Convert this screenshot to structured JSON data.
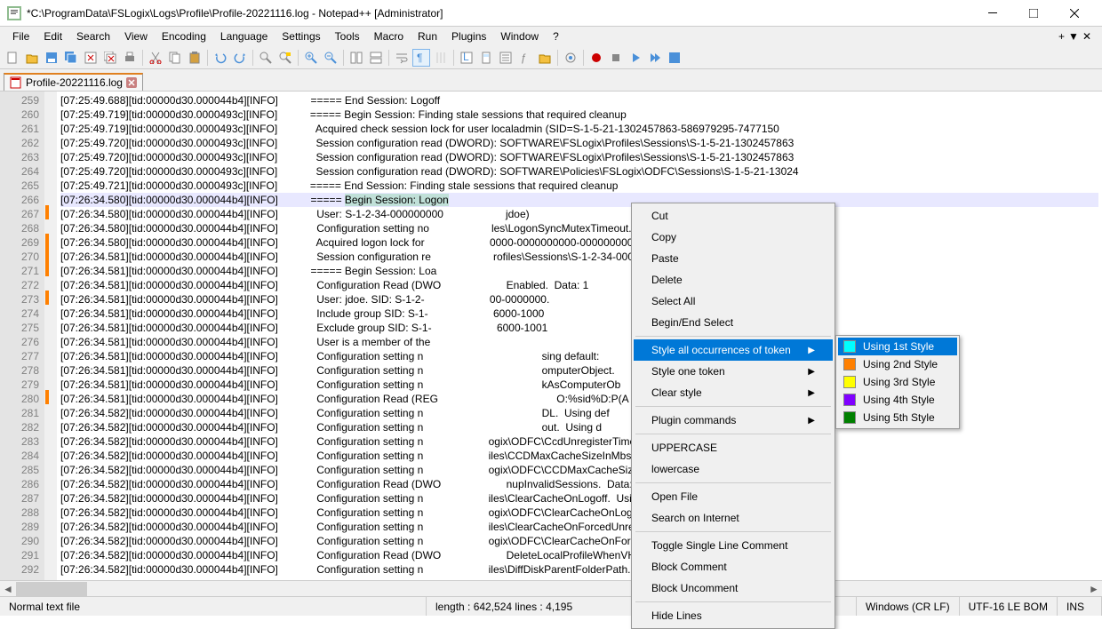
{
  "title": "*C:\\ProgramData\\FSLogix\\Logs\\Profile\\Profile-20221116.log - Notepad++ [Administrator]",
  "menus": [
    "File",
    "Edit",
    "Search",
    "View",
    "Encoding",
    "Language",
    "Settings",
    "Tools",
    "Macro",
    "Run",
    "Plugins",
    "Window",
    "?"
  ],
  "tab": {
    "name": "Profile-20221116.log"
  },
  "gutter_start": 259,
  "gutter_count": 34,
  "changed_lines": [
    267,
    269,
    270,
    271,
    273,
    280
  ],
  "highlighted_line": 266,
  "lines": [
    "[07:25:49.688][tid:00000d30.000044b4][INFO]           ===== End Session: Logoff",
    "[07:25:49.719][tid:00000d30.0000493c][INFO]           ===== Begin Session: Finding stale sessions that required cleanup",
    "[07:25:49.719][tid:00000d30.0000493c][INFO]             Acquired check session lock for user localadmin (SID=S-1-5-21-1302457863-586979295-7477150",
    "[07:25:49.720][tid:00000d30.0000493c][INFO]             Session configuration read (DWORD): SOFTWARE\\FSLogix\\Profiles\\Sessions\\S-1-5-21-1302457863",
    "[07:25:49.720][tid:00000d30.0000493c][INFO]             Session configuration read (DWORD): SOFTWARE\\FSLogix\\Profiles\\Sessions\\S-1-5-21-1302457863",
    "[07:25:49.720][tid:00000d30.0000493c][INFO]             Session configuration read (DWORD): SOFTWARE\\Policies\\FSLogix\\ODFC\\Sessions\\S-1-5-21-13024",
    "[07:25:49.721][tid:00000d30.0000493c][INFO]           ===== End Session: Finding stale sessions that required cleanup",
    "[07:26:34.580][tid:00000d30.000044b4][INFO]           ===== ",
    "[07:26:34.580][tid:00000d30.000044b4][INFO]             User: S-1-2-34-000000000                     jdoe)",
    "[07:26:34.580][tid:00000d30.000044b4][INFO]             Configuration setting no                     les\\LogonSyncMutexTimeout.  Using d",
    "[07:26:34.580][tid:00000d30.000044b4][INFO]             Acquired logon lock for                      0000-0000000000-0000000000-0000000) (E",
    "[07:26:34.581][tid:00000d30.000044b4][INFO]             Session configuration re                     rofiles\\Sessions\\S-1-2-34-000000000-",
    "[07:26:34.581][tid:00000d30.000044b4][INFO]           ===== Begin Session: Loa",
    "[07:26:34.581][tid:00000d30.000044b4][INFO]             Configuration Read (DWO                      Enabled.  Data: 1",
    "[07:26:34.581][tid:00000d30.000044b4][INFO]             User: jdoe. SID: S-1-2-                      00-0000000.",
    "[07:26:34.581][tid:00000d30.000044b4][INFO]             Include group SID: S-1-                      6000-1000",
    "[07:26:34.581][tid:00000d30.000044b4][INFO]             Exclude group SID: S-1-                      6000-1001",
    "[07:26:34.581][tid:00000d30.000044b4][INFO]             User is a member of the",
    "[07:26:34.581][tid:00000d30.000044b4][INFO]             Configuration setting n                                        sing default:",
    "[07:26:34.581][tid:00000d30.000044b4][INFO]             Configuration setting n                                        omputerObject.",
    "[07:26:34.581][tid:00000d30.000044b4][INFO]             Configuration setting n                                        kAsComputerOb",
    "[07:26:34.581][tid:00000d30.000044b4][INFO]             Configuration Read (REG                                        O:%sid%D:P(A",
    "[07:26:34.582][tid:00000d30.000044b4][INFO]             Configuration setting n                                        DL.  Using def",
    "[07:26:34.582][tid:00000d30.000044b4][INFO]             Configuration setting n                                        out.  Using d",
    "[07:26:34.582][tid:00000d30.000044b4][INFO]             Configuration setting n                      ogix\\ODFC\\CcdUnregisterTimeout.  Us",
    "[07:26:34.582][tid:00000d30.000044b4][INFO]             Configuration setting n                      iles\\CCDMaxCacheSizeInMbs.  Using d",
    "[07:26:34.582][tid:00000d30.000044b4][INFO]             Configuration setting n                      ogix\\ODFC\\CCDMaxCacheSizeInMbs.  Us",
    "[07:26:34.582][tid:00000d30.000044b4][INFO]             Configuration Read (DWO                      nupInvalidSessions.  Data: 1",
    "[07:26:34.582][tid:00000d30.000044b4][INFO]             Configuration setting n                      iles\\ClearCacheOnLogoff.  Using def",
    "[07:26:34.582][tid:00000d30.000044b4][INFO]             Configuration setting n                      ogix\\ODFC\\ClearCacheOnLogoff.  Usir",
    "[07:26:34.582][tid:00000d30.000044b4][INFO]             Configuration setting n                      iles\\ClearCacheOnForcedUnregister.",
    "[07:26:34.582][tid:00000d30.000044b4][INFO]             Configuration setting n                      ogix\\ODFC\\ClearCacheOnForcedUnregis",
    "[07:26:34.582][tid:00000d30.000044b4][INFO]             Configuration Read (DWO                      DeleteLocalProfileWhenVHDShouldAppl",
    "[07:26:34.582][tid:00000d30.000044b4][INFO]             Configuration setting n                      iles\\DiffDiskParentFolderPath.  Usi"
  ],
  "selected_text": "Begin Session: Logon",
  "context_menu": {
    "items": [
      {
        "label": "Cut"
      },
      {
        "label": "Copy"
      },
      {
        "label": "Paste"
      },
      {
        "label": "Delete"
      },
      {
        "label": "Select All"
      },
      {
        "label": "Begin/End Select"
      },
      {
        "sep": true
      },
      {
        "label": "Style all occurrences of token",
        "sub": true,
        "hl": true
      },
      {
        "label": "Style one token",
        "sub": true
      },
      {
        "label": "Clear style",
        "sub": true
      },
      {
        "sep": true
      },
      {
        "label": "Plugin commands",
        "sub": true
      },
      {
        "sep": true
      },
      {
        "label": "UPPERCASE"
      },
      {
        "label": "lowercase"
      },
      {
        "sep": true
      },
      {
        "label": "Open File"
      },
      {
        "label": "Search on Internet"
      },
      {
        "sep": true
      },
      {
        "label": "Toggle Single Line Comment"
      },
      {
        "label": "Block Comment"
      },
      {
        "label": "Block Uncomment"
      },
      {
        "sep": true
      },
      {
        "label": "Hide Lines"
      }
    ]
  },
  "sub_menu": {
    "items": [
      {
        "label": "Using 1st Style",
        "color": "#00ffff",
        "hl": true
      },
      {
        "label": "Using 2nd Style",
        "color": "#ff8000"
      },
      {
        "label": "Using 3rd Style",
        "color": "#ffff00"
      },
      {
        "label": "Using 4th Style",
        "color": "#8000ff"
      },
      {
        "label": "Using 5th Style",
        "color": "#008000"
      }
    ]
  },
  "status": {
    "left": "Normal text file",
    "length": "length : 642,524    lines : 4,195",
    "eol": "Windows (CR LF)",
    "encoding": "UTF-16 LE BOM",
    "mode": "INS"
  }
}
